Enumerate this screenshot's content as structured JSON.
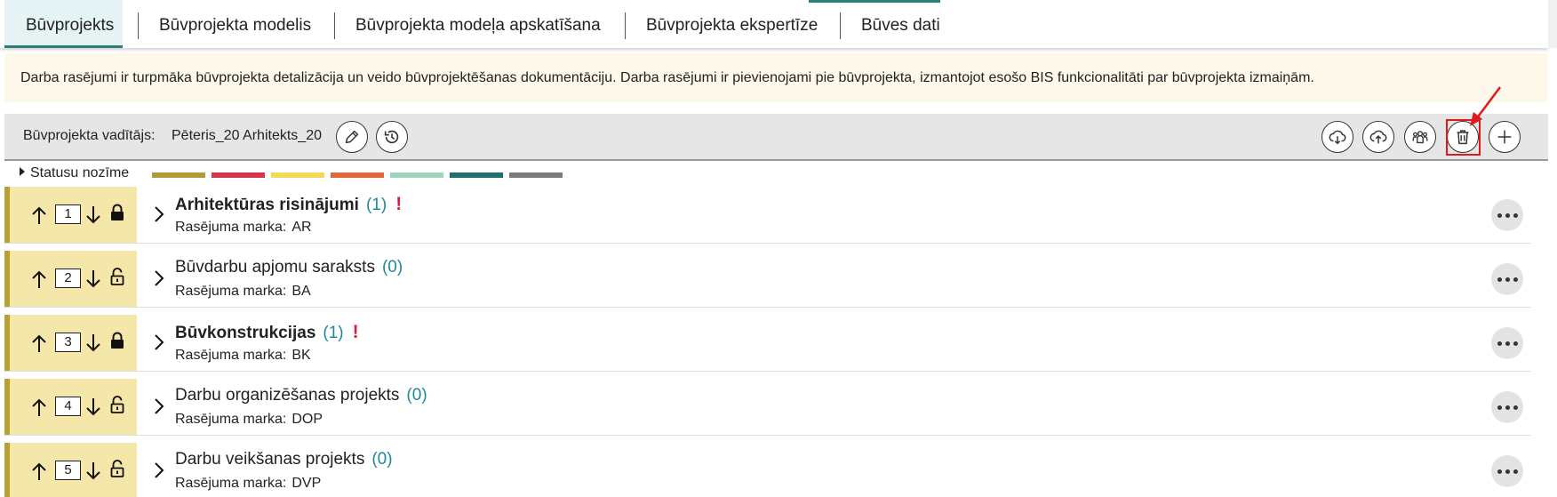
{
  "tabs": [
    {
      "label": "Būvprojekts",
      "active": true
    },
    {
      "label": "Būvprojekta modelis"
    },
    {
      "label": "Būvprojekta modeļa apskatīšana"
    },
    {
      "label": "Būvprojekta ekspertīze"
    },
    {
      "label": "Būves dati"
    }
  ],
  "banner": {
    "text": "Darba rasējumi ir turpmāka būvprojekta detalizācija un veido būvprojektēšanas dokumentāciju. Darba rasējumi ir pievienojami pie būvprojekta, izmantojot esošo BIS funkcionalitāti par būvprojekta izmaiņām."
  },
  "toolbar": {
    "manager_label": "Būvprojekta vadītājs:",
    "manager_name": "Pēteris_20 Arhitekts_20",
    "left_icons": [
      "edit-icon",
      "history-icon"
    ],
    "right_icons": [
      "cloud-download-icon",
      "cloud-upload-icon",
      "people-group-icon",
      "trash-icon",
      "plus-icon"
    ],
    "highlighted": "trash-icon"
  },
  "legend": {
    "label": "Statusu nozīme",
    "colors": [
      "#b19a3a",
      "#d6334d",
      "#f4d957",
      "#e0693a",
      "#9ed6bd",
      "#1f6f6f",
      "#7b7b7b"
    ]
  },
  "row_labels": {
    "mark_label": "Rasējuma marka:"
  },
  "rows": [
    {
      "num": "1",
      "title": "Arhitektūras risinājumi",
      "count": "(1)",
      "alert": "!",
      "mark": "AR",
      "bold": true,
      "locked": true
    },
    {
      "num": "2",
      "title": "Būvdarbu apjomu saraksts",
      "count": "(0)",
      "alert": "",
      "mark": "BA",
      "bold": false,
      "locked": false
    },
    {
      "num": "3",
      "title": "Būvkonstrukcijas",
      "count": "(1)",
      "alert": "!",
      "mark": "BK",
      "bold": true,
      "locked": true
    },
    {
      "num": "4",
      "title": "Darbu organizēšanas projekts",
      "count": "(0)",
      "alert": "",
      "mark": "DOP",
      "bold": false,
      "locked": false
    },
    {
      "num": "5",
      "title": "Darbu veikšanas projekts",
      "count": "(0)",
      "alert": "",
      "mark": "DVP",
      "bold": false,
      "locked": false
    }
  ]
}
